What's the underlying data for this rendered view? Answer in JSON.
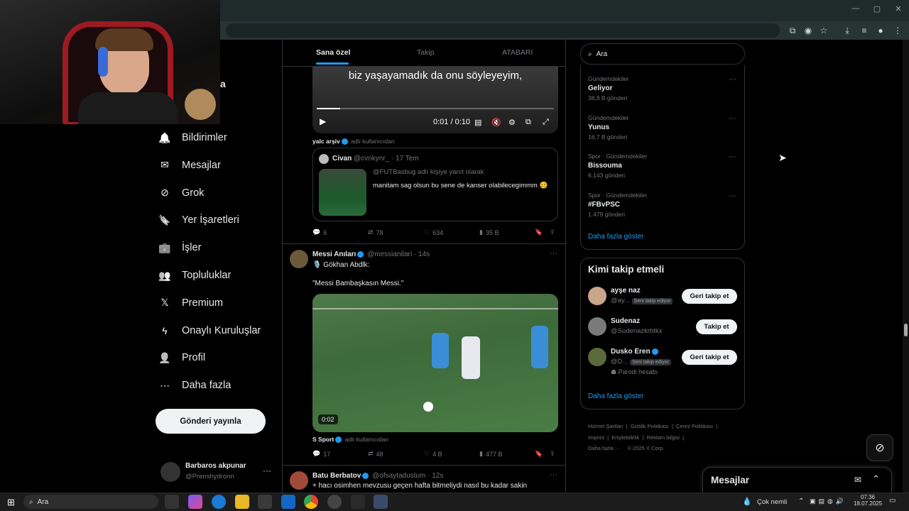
{
  "feed_tabs": [
    "Sana özel",
    "Takip",
    "ATABARI"
  ],
  "nav": {
    "items": [
      {
        "label": "Bildirimler",
        "icon": "bell-icon"
      },
      {
        "label": "Mesajlar",
        "icon": "envelope-icon"
      },
      {
        "label": "Grok",
        "icon": "grok-icon"
      },
      {
        "label": "Yer İşaretleri",
        "icon": "bookmark-icon"
      },
      {
        "label": "İşler",
        "icon": "briefcase-icon"
      },
      {
        "label": "Topluluklar",
        "icon": "people-icon"
      },
      {
        "label": "Premium",
        "icon": "x-logo-icon"
      },
      {
        "label": "Onaylı Kuruluşlar",
        "icon": "lightning-icon"
      },
      {
        "label": "Profil",
        "icon": "person-icon"
      },
      {
        "label": "Daha fazla",
        "icon": "more-circle-icon"
      }
    ],
    "post_button": "Gönderi yayınla",
    "account": {
      "name": "Barbaros akpunar",
      "handle": "@Prenshydronn"
    },
    "partial_label": "a"
  },
  "video1": {
    "subtitle": "biz yaşayamadık da onu söyleyeyim,",
    "time": "0:01 / 0:10"
  },
  "post1": {
    "attribution_name": "yalc arşiv",
    "attribution_suffix": "adlı kullanıcıdan",
    "quote": {
      "name": "Civan",
      "handle": "@cvnkynr_",
      "time": "· 17 Tem",
      "reply_to": "@FUTBasbug adlı kişiye yanıt olarak",
      "text": "manitam sag olsun bu sene de kanser olabilecegimmm 🥴"
    },
    "stats": {
      "replies": "6",
      "reposts": "78",
      "likes": "634",
      "views": "35 B"
    }
  },
  "post2": {
    "name": "Messi Anıları",
    "handle": "@messianilari",
    "time": "· 14s",
    "line1": "🎙️ Gökhan Abdlk:",
    "line2": "\"Messi Bambaşkasın Messi.\"",
    "video_duration": "0:02",
    "attribution_name": "S Sport",
    "attribution_suffix": "adlı kullanıcıdan",
    "stats": {
      "replies": "17",
      "reposts": "48",
      "likes": "4 B",
      "views": "477 B"
    }
  },
  "post3": {
    "name": "Batu Berbatov",
    "handle": "@ofsaytadustum",
    "time": "· 12s",
    "text": "+ hacı osimhen mevzusu geçen hafta bitmeliydi nasıl bu kadar sakin"
  },
  "search": {
    "placeholder": "Ara"
  },
  "trends": [
    {
      "category": "Gündemdekiler",
      "title": "Geliyor",
      "count": "38,8 B gönderi"
    },
    {
      "category": "Gündemdekiler",
      "title": "Yunus",
      "count": "16,7 B gönderi"
    },
    {
      "category": "Spor · Gündemdekiler",
      "title": "Bissouma",
      "count": "6.143 gönderi"
    },
    {
      "category": "Spor · Gündemdekiler",
      "title": "#FBvPSC",
      "count": "1.479 gönderi"
    }
  ],
  "trends_more": "Daha fazla göster",
  "who_to_follow": {
    "title": "Kimi takip etmeli",
    "users": [
      {
        "name": "ayşe naz",
        "handle": "@ay...",
        "tag": "Seni takip ediyor",
        "button": "Geri takip et"
      },
      {
        "name": "Sudenaz",
        "handle": "@Sudenazkrbtkx",
        "button": "Takip et"
      },
      {
        "name": "Dusko Eren",
        "handle": "@D...",
        "tag": "Seni takip ediyor",
        "note": "Parodi hesabı",
        "button": "Geri takip et"
      }
    ],
    "more": "Daha fazla göster"
  },
  "footer": {
    "links": [
      "Hizmet Şartları",
      "Gizlilik Politikası",
      "Çerez Politikası",
      "Imprint",
      "Erişilebilirlik",
      "Reklam bilgisi",
      "Daha fazla ···"
    ],
    "copyright": "© 2025 X Corp."
  },
  "messages_dock": {
    "title": "Mesajlar"
  },
  "taskbar": {
    "search": "Ara",
    "weather": "Çok nemli",
    "time": "07:36",
    "date": "18.07.2025"
  },
  "colors": {
    "accent": "#1d9bf0",
    "background": "#000000",
    "border": "#2f3336"
  }
}
